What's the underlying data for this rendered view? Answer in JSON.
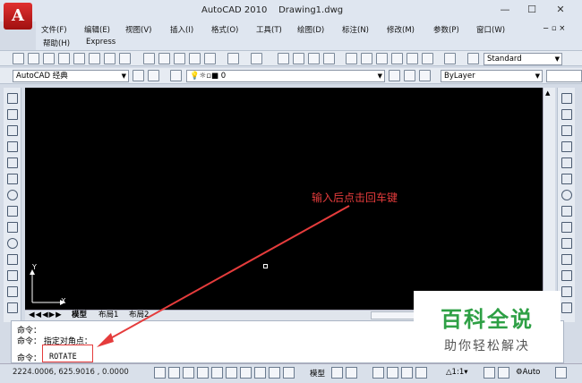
{
  "window": {
    "title": "AutoCAD 2010",
    "document": "Drawing1.dwg",
    "app_button": "A",
    "minimize": "—",
    "maximize": "☐",
    "close": "✕",
    "doc_controls": "− ▫ ×"
  },
  "menu": [
    "文件(F)",
    "编辑(E)",
    "视图(V)",
    "插入(I)",
    "格式(O)",
    "工具(T)",
    "绘图(D)",
    "标注(N)",
    "修改(M)",
    "参数(P)",
    "窗口(W)",
    "帮助(H)",
    "Express"
  ],
  "toolbar": {
    "text_style": "Standard",
    "workspace": "AutoCAD 经典",
    "layer": "0",
    "color": "ByLayer"
  },
  "drawing": {
    "annotation": "输入后点击回车键",
    "ucs_y": "Y",
    "ucs_x": "X"
  },
  "tabs": {
    "model": "模型",
    "layout1": "布局1",
    "layout2": "布局2"
  },
  "command": {
    "line1": "命令：",
    "line2": "命令：  指定对角点：",
    "prompt": "命令：",
    "input": "ROTATE"
  },
  "status": {
    "coords": "2224.0006, 625.9016 , 0.0000",
    "model_label": "模型",
    "scale": "1:1",
    "auto": "Auto"
  },
  "watermark": {
    "title": "百科全说",
    "subtitle": "助你轻松解决"
  },
  "colors": {
    "annotation": "#e53c3c",
    "watermark_green": "#2ea045",
    "canvas": "#000000"
  }
}
